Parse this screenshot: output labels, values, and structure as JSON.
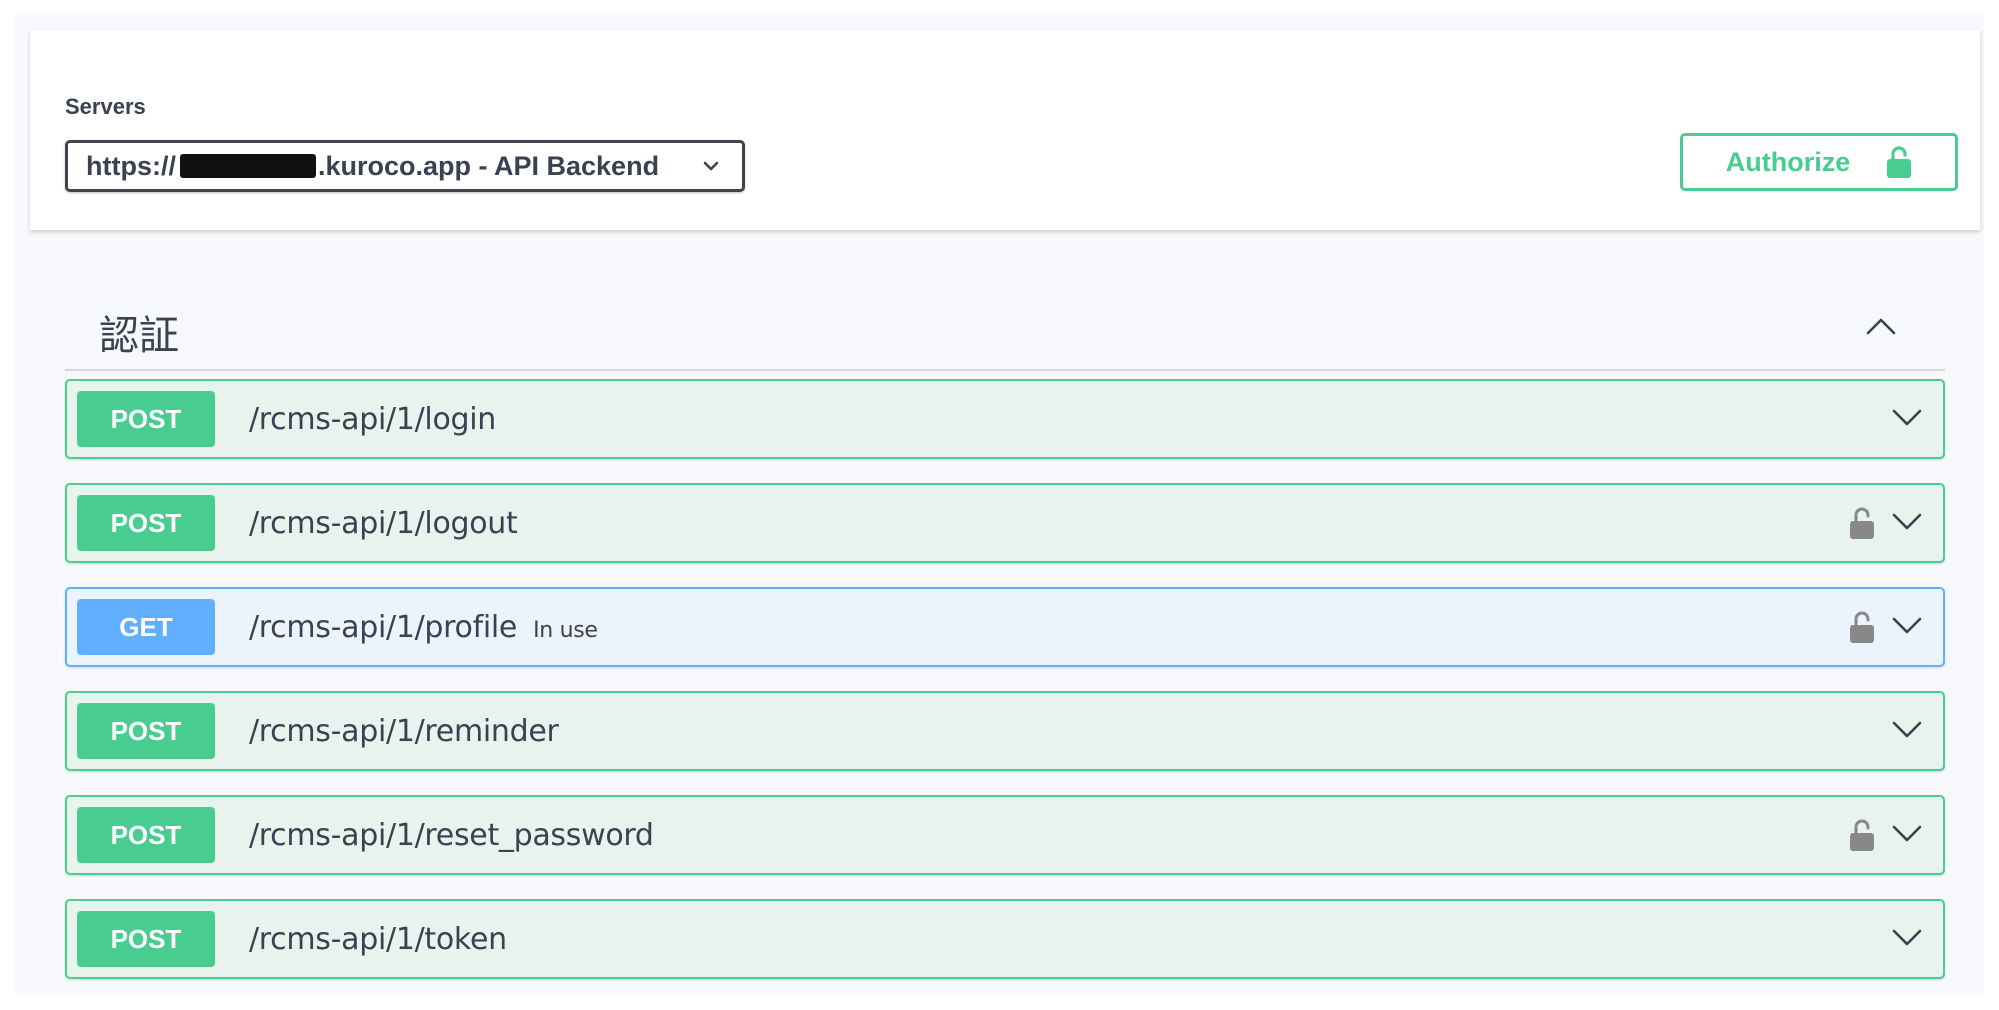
{
  "servers": {
    "label": "Servers",
    "prefix": "https://",
    "suffix": ".kuroco.app - API Backend",
    "caret_icon": "chevron-down-icon"
  },
  "authorize": {
    "label": "Authorize",
    "icon": "unlock-icon"
  },
  "tag": {
    "title": "認証",
    "toggle_icon": "chevron-up-icon"
  },
  "operations": [
    {
      "method": "POST",
      "path": "/rcms-api/1/login",
      "summary": "",
      "locked": false
    },
    {
      "method": "POST",
      "path": "/rcms-api/1/logout",
      "summary": "",
      "locked": true
    },
    {
      "method": "GET",
      "path": "/rcms-api/1/profile",
      "summary": "In use",
      "locked": true
    },
    {
      "method": "POST",
      "path": "/rcms-api/1/reminder",
      "summary": "",
      "locked": false
    },
    {
      "method": "POST",
      "path": "/rcms-api/1/reset_password",
      "summary": "",
      "locked": true
    },
    {
      "method": "POST",
      "path": "/rcms-api/1/token",
      "summary": "",
      "locked": false
    }
  ],
  "colors": {
    "post": "#49cc90",
    "get": "#61affe",
    "post_bg": "#e8f3ee",
    "get_bg": "#ebf3fd",
    "text": "#3b4151"
  }
}
